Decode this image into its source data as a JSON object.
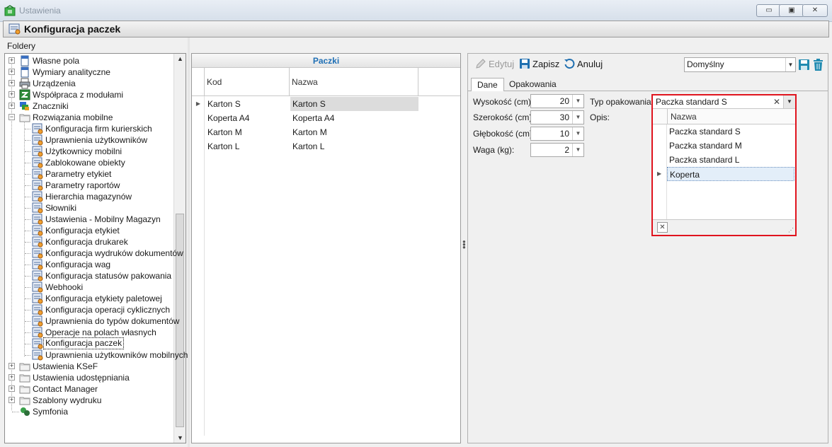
{
  "window": {
    "title": "Ustawienia",
    "min_label": "▭",
    "restore_label": "▣",
    "close_label": "✕"
  },
  "header": {
    "title": "Konfiguracja paczek"
  },
  "folders": {
    "label": "Foldery",
    "items": [
      {
        "label": "Własne pola",
        "level": 0,
        "expander": "+",
        "icon": "document-icon"
      },
      {
        "label": "Wymiary analityczne",
        "level": 0,
        "expander": "+",
        "icon": "document-icon"
      },
      {
        "label": "Urządzenia",
        "level": 0,
        "expander": "+",
        "icon": "printer-icon"
      },
      {
        "label": "Współpraca z modułami",
        "level": 0,
        "expander": "+",
        "icon": "modules-icon"
      },
      {
        "label": "Znaczniki",
        "level": 0,
        "expander": "+",
        "icon": "markers-icon"
      },
      {
        "label": "Rozwiązania mobilne",
        "level": 0,
        "expander": "−",
        "icon": "folder-icon"
      },
      {
        "label": "Konfiguracja firm kurierskich",
        "level": 1,
        "icon": "config-icon"
      },
      {
        "label": "Uprawnienia użytkowników",
        "level": 1,
        "icon": "config-icon"
      },
      {
        "label": "Użytkownicy mobilni",
        "level": 1,
        "icon": "config-icon"
      },
      {
        "label": "Zablokowane obiekty",
        "level": 1,
        "icon": "config-icon"
      },
      {
        "label": "Parametry etykiet",
        "level": 1,
        "icon": "config-icon"
      },
      {
        "label": "Parametry raportów",
        "level": 1,
        "icon": "config-icon"
      },
      {
        "label": "Hierarchia magazynów",
        "level": 1,
        "icon": "config-icon"
      },
      {
        "label": "Słowniki",
        "level": 1,
        "icon": "config-icon"
      },
      {
        "label": "Ustawienia - Mobilny Magazyn",
        "level": 1,
        "icon": "config-icon"
      },
      {
        "label": "Konfiguracja etykiet",
        "level": 1,
        "icon": "config-icon"
      },
      {
        "label": "Konfiguracja drukarek",
        "level": 1,
        "icon": "config-icon"
      },
      {
        "label": "Konfiguracja wydruków dokumentów",
        "level": 1,
        "icon": "config-icon"
      },
      {
        "label": "Konfiguracja wag",
        "level": 1,
        "icon": "config-icon"
      },
      {
        "label": "Konfiguracja statusów pakowania",
        "level": 1,
        "icon": "config-icon"
      },
      {
        "label": "Webhooki",
        "level": 1,
        "icon": "config-icon"
      },
      {
        "label": "Konfiguracja etykiety paletowej",
        "level": 1,
        "icon": "config-icon"
      },
      {
        "label": "Konfiguracja operacji cyklicznych",
        "level": 1,
        "icon": "config-icon"
      },
      {
        "label": "Uprawnienia do typów dokumentów",
        "level": 1,
        "icon": "config-icon"
      },
      {
        "label": "Operacje na polach własnych",
        "level": 1,
        "icon": "config-icon"
      },
      {
        "label": "Konfiguracja paczek",
        "level": 1,
        "icon": "config-icon",
        "selected": true
      },
      {
        "label": "Uprawnienia użytkowników mobilnych",
        "level": 1,
        "icon": "config-icon"
      },
      {
        "label": "Ustawienia KSeF",
        "level": 0,
        "expander": "+",
        "icon": "folder-icon"
      },
      {
        "label": "Ustawienia udostępniania",
        "level": 0,
        "expander": "+",
        "icon": "folder-icon"
      },
      {
        "label": "Contact Manager",
        "level": 0,
        "expander": "+",
        "icon": "folder-icon"
      },
      {
        "label": "Szablony wydruku",
        "level": 0,
        "expander": "+",
        "icon": "folder-icon"
      },
      {
        "label": "Symfonia",
        "level": 0,
        "icon": "symfonia-icon"
      }
    ]
  },
  "packages": {
    "caption": "Paczki",
    "columns": [
      "Kod",
      "Nazwa"
    ],
    "rows": [
      {
        "kod": "Karton S",
        "nazwa": "Karton S",
        "current": true
      },
      {
        "kod": "Koperta A4",
        "nazwa": "Koperta A4"
      },
      {
        "kod": "Karton M",
        "nazwa": "Karton M"
      },
      {
        "kod": "Karton L",
        "nazwa": "Karton L"
      }
    ]
  },
  "toolbar": {
    "edit_label": "Edytuj",
    "save_label": "Zapisz",
    "cancel_label": "Anuluj",
    "profile_value": "Domyślny"
  },
  "tabs": [
    "Dane",
    "Opakowania"
  ],
  "form": {
    "height_label": "Wysokość (cm):",
    "height_value": "20",
    "width_label": "Szerokość (cm):",
    "width_value": "30",
    "depth_label": "Głębokość (cm):",
    "depth_value": "10",
    "weight_label": "Waga (kg):",
    "weight_value": "2",
    "type_label": "Typ opakowania:",
    "desc_label": "Opis:"
  },
  "lookup": {
    "value": "Paczka standard S",
    "column": "Nazwa",
    "items": [
      "Paczka standard S",
      "Paczka standard M",
      "Paczka standard L",
      "Koperta"
    ],
    "focused_index": 3
  },
  "colors": {
    "accent_blue": "#1e6fb5",
    "highlight_red": "#e0141e",
    "selection": "#e3eef9"
  }
}
